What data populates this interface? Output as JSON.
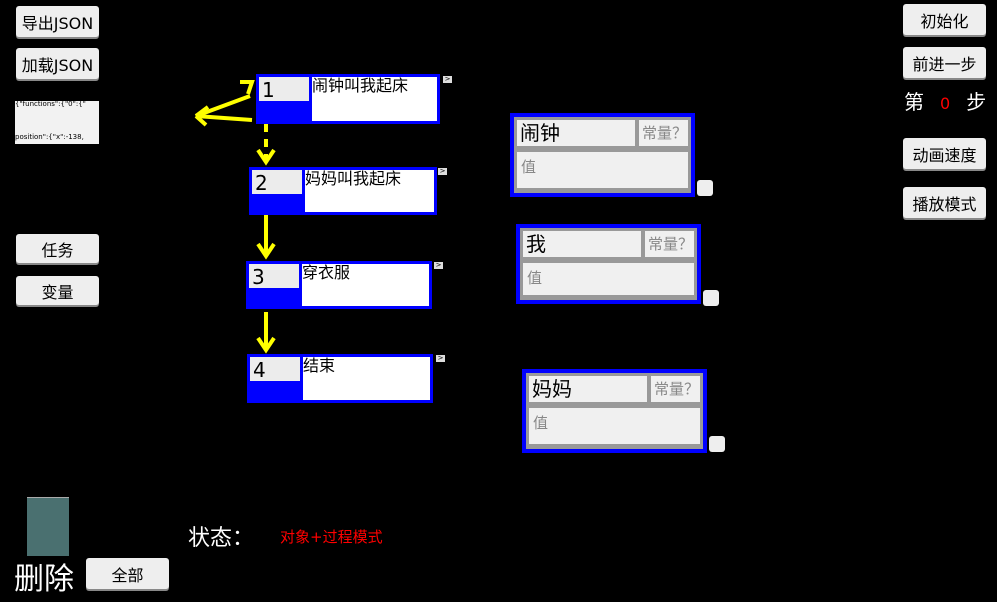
{
  "left": {
    "export": "导出JSON",
    "load": "加载JSON",
    "json_text_top": "{\"functions\":{\"0\":{\"",
    "json_text_bottom": "position\":{\"x\":-138,",
    "tasks": "任务",
    "variables": "变量"
  },
  "right": {
    "init": "初始化",
    "step": "前进一步",
    "step_prefix": "第",
    "step_num": "0",
    "step_suffix": "步",
    "speed": "动画速度",
    "play": "播放模式"
  },
  "tasks": [
    {
      "num": "1",
      "name": "闹钟叫我起床"
    },
    {
      "num": "2",
      "name": "妈妈叫我起床"
    },
    {
      "num": "3",
      "name": "穿衣服"
    },
    {
      "num": "4",
      "name": "结束"
    }
  ],
  "task_marker": ">",
  "variables": [
    {
      "name": "闹钟",
      "const": "常量？",
      "value": "值"
    },
    {
      "name": "我",
      "const": "常量？",
      "value": "值"
    },
    {
      "name": "妈妈",
      "const": "常量？",
      "value": "值"
    }
  ],
  "bottom": {
    "delete": "删除",
    "all": "全部",
    "status_label": "状态：",
    "status_value": "对象+过程模式"
  },
  "colors": {
    "accent": "#0000ff",
    "arrow": "#ffff00",
    "status": "#ff0000"
  }
}
